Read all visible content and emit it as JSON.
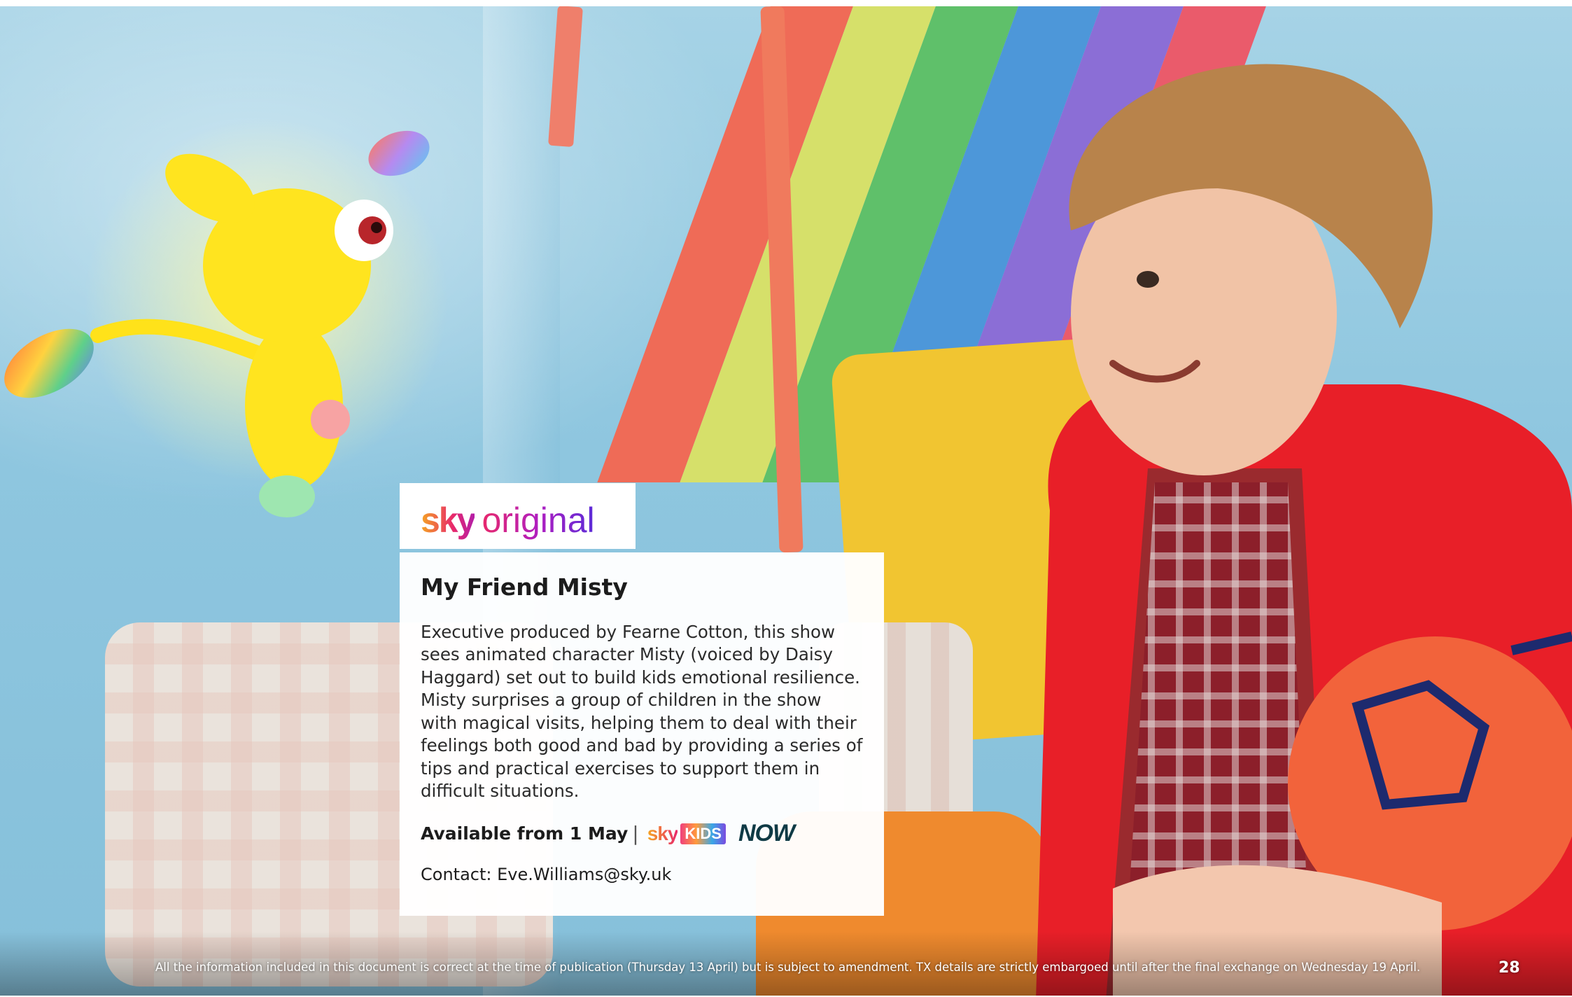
{
  "logo": {
    "brand": "sky",
    "product": "original"
  },
  "card": {
    "title": "My Friend Misty",
    "body": "Executive produced by Fearne Cotton, this show sees animated character Misty (voiced by Daisy Haggard) set out to build kids emotional resilience. Misty surprises a group of children in the show with magical visits, helping them to deal with their feelings both good and bad by providing a series of tips and practical exercises to support them in difficult situations.",
    "availability": "Available from 1 May",
    "separator": "|",
    "channel_logos": {
      "sky_kids_brand": "sky",
      "sky_kids_badge": "KIDS",
      "now": "NOW"
    },
    "contact": "Contact: Eve.Williams@sky.uk"
  },
  "footer": {
    "disclaimer": "All the information included in this document is correct at the time of publication (Thursday 13 April) but is subject to amendment. TX details are strictly embargoed until after the final exchange on Wednesday 19 April.",
    "page_number": "28"
  },
  "colors": {
    "sky_gradient_start": "#f5a623",
    "sky_gradient_mid": "#e8286b",
    "original_gradient_end": "#5a2bd8",
    "now_brand": "#0f3a45",
    "card_background": "#ffffff"
  },
  "icons": [
    "sky-original-logo",
    "sky-kids-logo",
    "now-logo"
  ]
}
